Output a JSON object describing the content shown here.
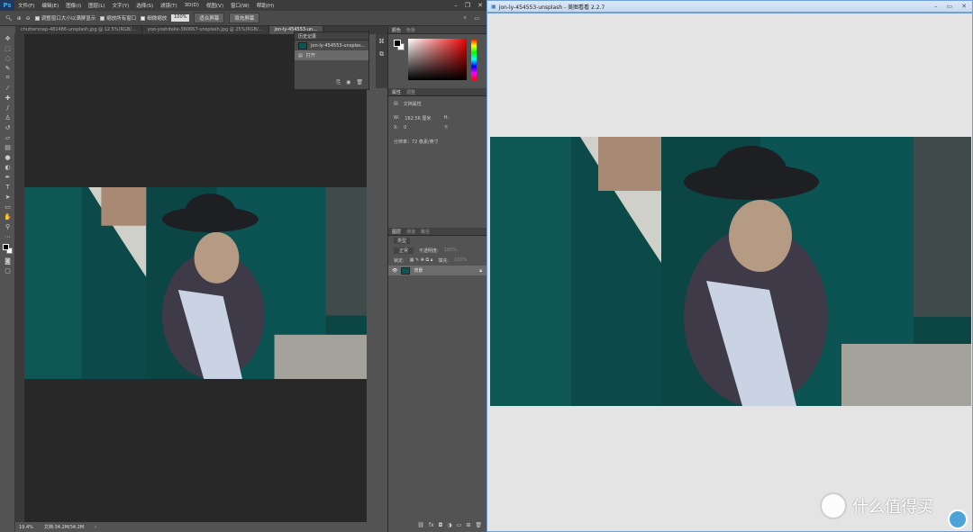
{
  "photoshop": {
    "logo": "Ps",
    "menu": [
      "文件(F)",
      "编辑(E)",
      "图像(I)",
      "图层(L)",
      "文字(Y)",
      "选择(S)",
      "滤镜(T)",
      "3D(D)",
      "视图(V)",
      "窗口(W)",
      "帮助(H)"
    ],
    "options": {
      "resize_windows": "调整窗口大小以满屏显示",
      "zoom_all": "缩放所有窗口",
      "scrubby_zoom": "细微缩放",
      "zoom_value": "100%",
      "fit_screen": "适合屏幕",
      "fill_screen": "填充屏幕"
    },
    "tabs": [
      "chuttersnap-481486-unsplash.jpg @ 12.5%(RGB/...",
      "yoo-yoshitake-360667-unsplash.jpg @ 25%(RGB/...",
      "jon-ly-454553-un..."
    ],
    "history": {
      "tab": "历史记录",
      "snapshot": "jon-ly-454553-unsplas...",
      "step": "打开"
    },
    "color_panel": {
      "tab_color": "颜色",
      "tab_swatches": "色板"
    },
    "properties": {
      "tab": "属性",
      "tab_adjust": "调整",
      "title": "文档属性",
      "w_label": "W:",
      "w_value": "162.56 厘米",
      "h_label": "H:",
      "x_label": "X:",
      "x_value": "0",
      "y_label": "Y:",
      "resolution": "分辨率：72 像素/英寸"
    },
    "layers": {
      "tabs": [
        "图层",
        "通道",
        "路径"
      ],
      "kind": "类型",
      "blend": "正常",
      "opacity_label": "不透明度:",
      "opacity": "100%",
      "lock_label": "锁定:",
      "fill_label": "填充:",
      "fill": "100%",
      "layer_name": "背景"
    },
    "status": {
      "zoom": "19.4%",
      "doc": "文档:34.2M/34.2M"
    }
  },
  "viewer": {
    "title": "jon-ly-454553-unsplash - 美图看看 2.2.7"
  },
  "watermark": "什么值得买",
  "colors": {
    "teal": "#0d4a48",
    "ps_bg": "#535353",
    "canvas": "#282828",
    "viewer_bg": "#e4e4e4"
  }
}
